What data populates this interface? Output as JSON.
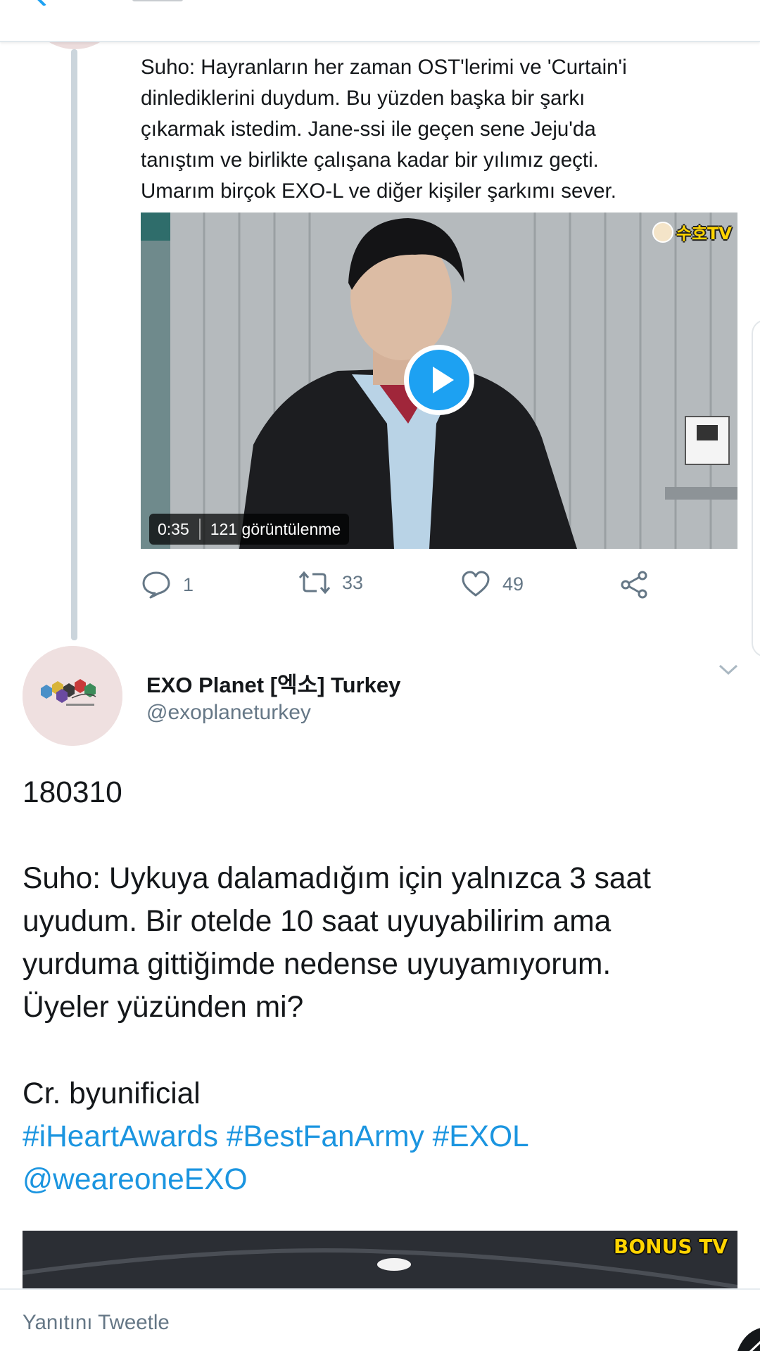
{
  "previous_tweet": {
    "text_lines": [
      "Suho: Hayranların her zaman OST'lerimi ve 'Curtain'i",
      "dinlediklerini duydum. Bu yüzden başka bir şarkı",
      "çıkarmak istedim. Jane-ssi ile geçen sene Jeju'da",
      "tanıştım ve birlikte çalışana kadar bir yılımız geçti.",
      "Umarım birçok EXO-L ve diğer kişiler şarkımı sever."
    ],
    "video": {
      "channel_badge": "수호TV",
      "duration": "0:35",
      "views": "121 görüntülenme"
    },
    "actions": {
      "reply_count": "1",
      "retweet_count": "33",
      "like_count": "49"
    }
  },
  "tweet": {
    "author_name": "EXO Planet [엑소] Turkey",
    "handle": "@exoplaneturkey",
    "date_line": "180310",
    "body_lines": [
      "Suho: Uykuya dalamadığım için yalnızca 3 saat",
      "uyudum. Bir otelde 10 saat uyuyabilirim ama",
      "yurduma gittiğimde nedense uyuyamıyorum.",
      "Üyeler yüzünden mi?"
    ],
    "credit": "Cr. byunificial",
    "hashtags": [
      "#iHeartAwards",
      "#BestFanArmy",
      "#EXOL"
    ],
    "mention": "@weareoneEXO",
    "media_badge": "BONUS TV"
  },
  "reply_bar": {
    "placeholder": "Yanıtını Tweetle"
  },
  "colors": {
    "accent": "#1da1f2",
    "link": "#1b95e0",
    "muted": "#657786",
    "badge_yellow": "#ffd400"
  },
  "icons": [
    "back-arrow-icon",
    "reply-icon",
    "retweet-icon",
    "like-icon",
    "share-icon",
    "chevron-down-icon",
    "play-icon"
  ]
}
